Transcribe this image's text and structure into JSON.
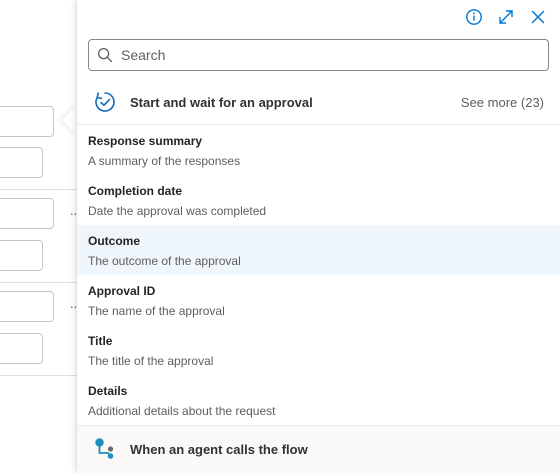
{
  "search": {
    "placeholder": "Search",
    "value": ""
  },
  "header_icons": [
    "info-icon",
    "expand-icon",
    "close-icon"
  ],
  "section": {
    "title": "Start and wait for an approval",
    "see_more": "See more (23)",
    "icon": "approval-icon"
  },
  "items": [
    {
      "name": "Response summary",
      "desc": "A summary of the responses"
    },
    {
      "name": "Completion date",
      "desc": "Date the approval was completed"
    },
    {
      "name": "Outcome",
      "desc": "The outcome of the approval"
    },
    {
      "name": "Approval ID",
      "desc": "The name of the approval"
    },
    {
      "name": "Title",
      "desc": "The title of the approval"
    },
    {
      "name": "Details",
      "desc": "Additional details about the request"
    }
  ],
  "footer": {
    "label": "When an agent calls the flow",
    "icon": "agent-flow-icon"
  },
  "colors": {
    "accent": "#0078d4",
    "hover": "#eff6fc",
    "approval_icon": "#0f6cbd",
    "agent_icon": "#1b8fbd"
  }
}
